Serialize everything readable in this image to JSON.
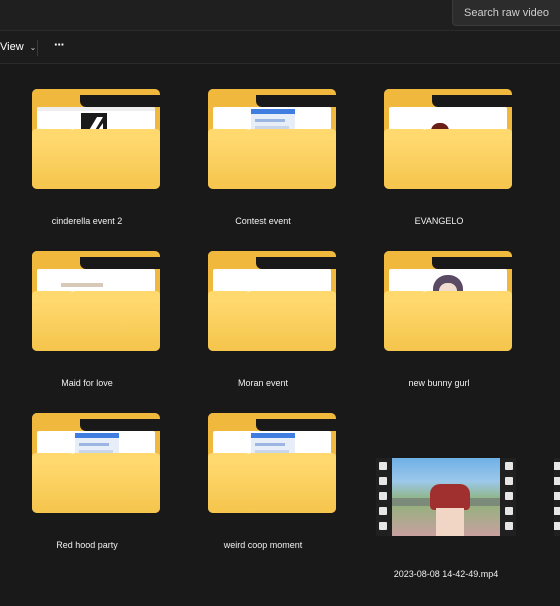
{
  "search": {
    "placeholder": "Search raw video"
  },
  "toolbar": {
    "view_label": "View",
    "more_label": "···"
  },
  "items": [
    {
      "name": "cinderella event 2",
      "type": "folder",
      "thumb": "doc-logo"
    },
    {
      "name": "Contest event",
      "type": "folder",
      "thumb": "screen"
    },
    {
      "name": "EVANGELO",
      "type": "folder",
      "thumb": "fire"
    },
    {
      "name": "Maid for love",
      "type": "folder",
      "thumb": "room"
    },
    {
      "name": "Moran event",
      "type": "folder",
      "thumb": "blank"
    },
    {
      "name": "new bunny gurl",
      "type": "folder",
      "thumb": "anime"
    },
    {
      "name": "Red hood party",
      "type": "folder",
      "thumb": "screen"
    },
    {
      "name": "weird coop moment",
      "type": "folder",
      "thumb": "screen"
    },
    {
      "name": "2023-08-08 14-42-49.mp4",
      "type": "video",
      "thumb": "video-frame"
    }
  ],
  "colors": {
    "folder": "#f0b93e",
    "folder_front": "#ffd86e",
    "background": "#191919"
  }
}
